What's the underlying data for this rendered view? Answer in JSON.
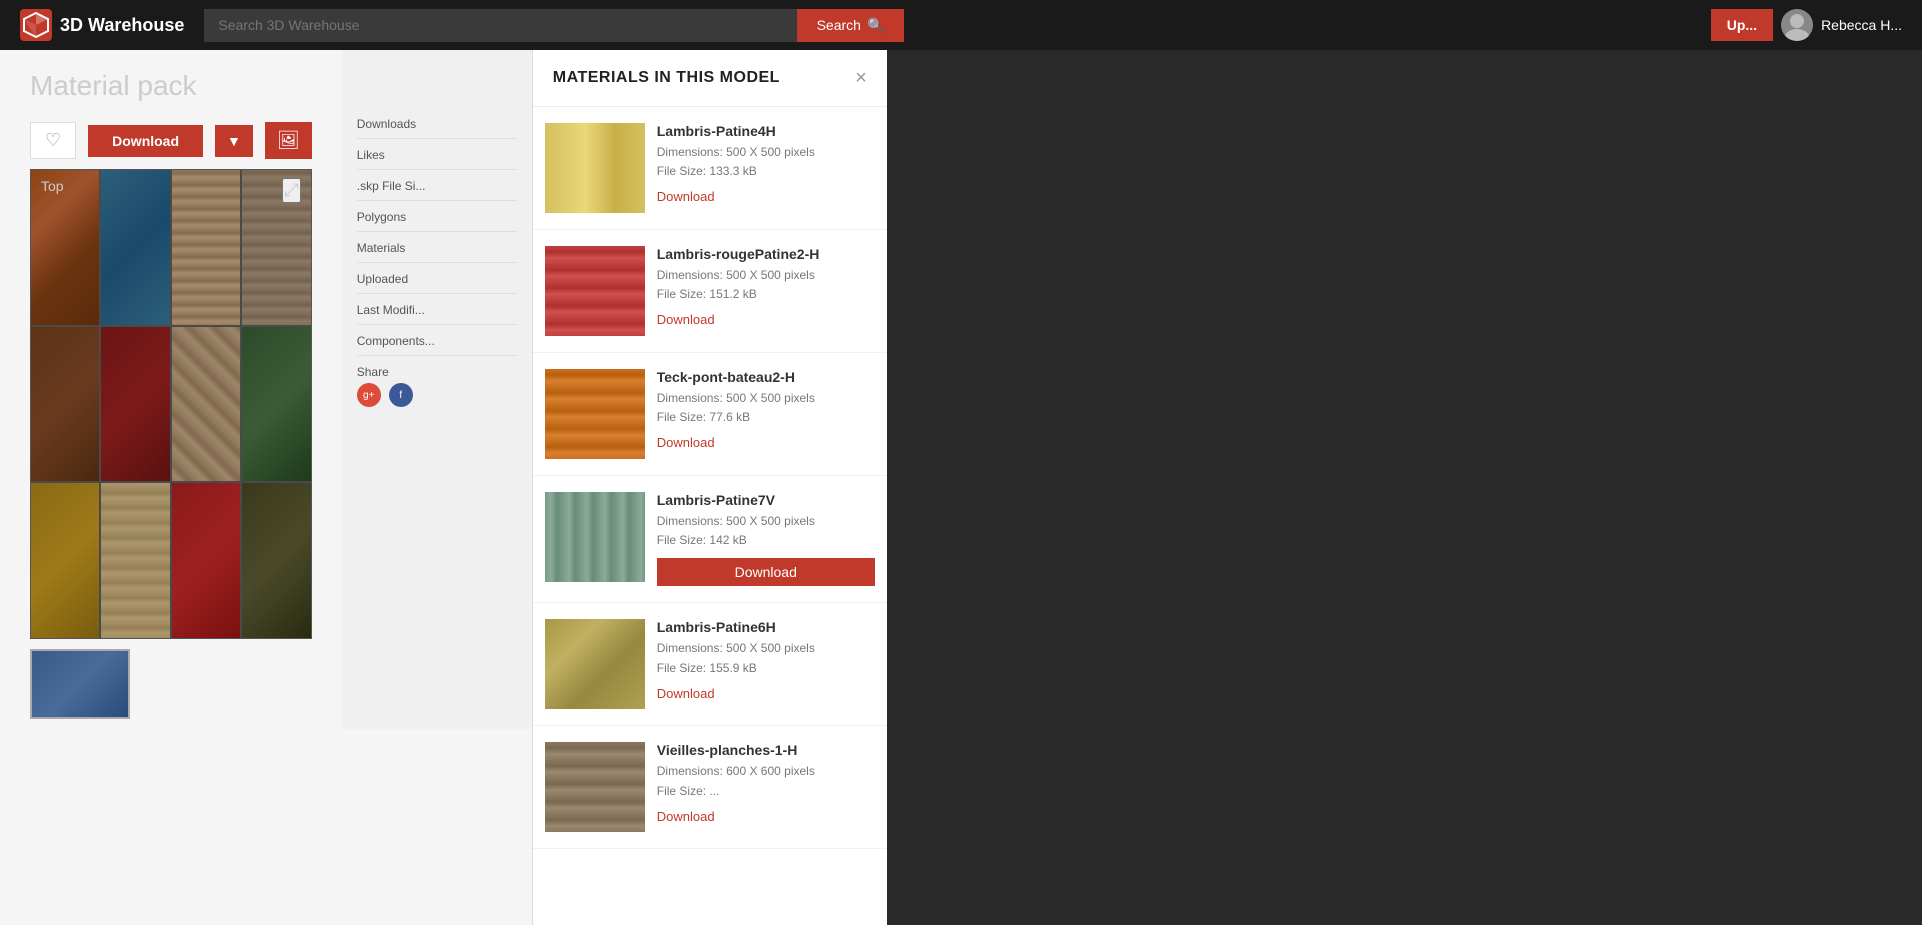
{
  "app": {
    "name": "3D Warehouse",
    "logo_text": "3D Warehouse"
  },
  "header": {
    "search_placeholder": "Search 3D Warehouse",
    "search_button_label": "Search",
    "upload_button_label": "Up...",
    "user_name": "Rebecca H..."
  },
  "page": {
    "title": "Material pack",
    "top_label": "Top"
  },
  "actions": {
    "download_label": "Download",
    "heart_label": "♡",
    "more_label": "▼"
  },
  "meta_sidebar": {
    "items": [
      {
        "label": "Downloads"
      },
      {
        "label": "Likes"
      },
      {
        "label": ".skp File Si..."
      },
      {
        "label": "Polygons"
      },
      {
        "label": "Materials"
      },
      {
        "label": "Uploaded"
      },
      {
        "label": "Last Modifi..."
      },
      {
        "label": "Components..."
      }
    ],
    "share_label": "Share"
  },
  "materials_panel": {
    "title": "MATERIALS IN THIS MODEL",
    "close_label": "×",
    "scrollbar_visible": true,
    "items": [
      {
        "id": "lambris4h",
        "name": "Lambris-Patine4H",
        "dimensions": "Dimensions: 500 X 500 pixels",
        "file_size": "File Size: 133.3 kB",
        "download_label": "Download",
        "thumb_class": "thumb-lambris4h",
        "active": false
      },
      {
        "id": "rouge2h",
        "name": "Lambris-rougePatine2-H",
        "dimensions": "Dimensions: 500 X 500 pixels",
        "file_size": "File Size: 151.2 kB",
        "download_label": "Download",
        "thumb_class": "thumb-rouge2h",
        "active": false
      },
      {
        "id": "teck2h",
        "name": "Teck-pont-bateau2-H",
        "dimensions": "Dimensions: 500 X 500 pixels",
        "file_size": "File Size: 77.6 kB",
        "download_label": "Download",
        "thumb_class": "thumb-teck2h",
        "active": false
      },
      {
        "id": "patine7v",
        "name": "Lambris-Patine7V",
        "dimensions": "Dimensions: 500 X 500 pixels",
        "file_size": "File Size: 142 kB",
        "download_label": "Download",
        "thumb_class": "thumb-patine7v",
        "active": true
      },
      {
        "id": "patine6h",
        "name": "Lambris-Patine6H",
        "dimensions": "Dimensions: 500 X 500 pixels",
        "file_size": "File Size: 155.9 kB",
        "download_label": "Download",
        "thumb_class": "thumb-patine6h",
        "active": false
      },
      {
        "id": "vieilles",
        "name": "Vieilles-planches-1-H",
        "dimensions": "Dimensions: 600 X 600 pixels",
        "file_size": "File Size: ...",
        "download_label": "Download",
        "thumb_class": "thumb-vieilles",
        "active": false
      }
    ]
  }
}
